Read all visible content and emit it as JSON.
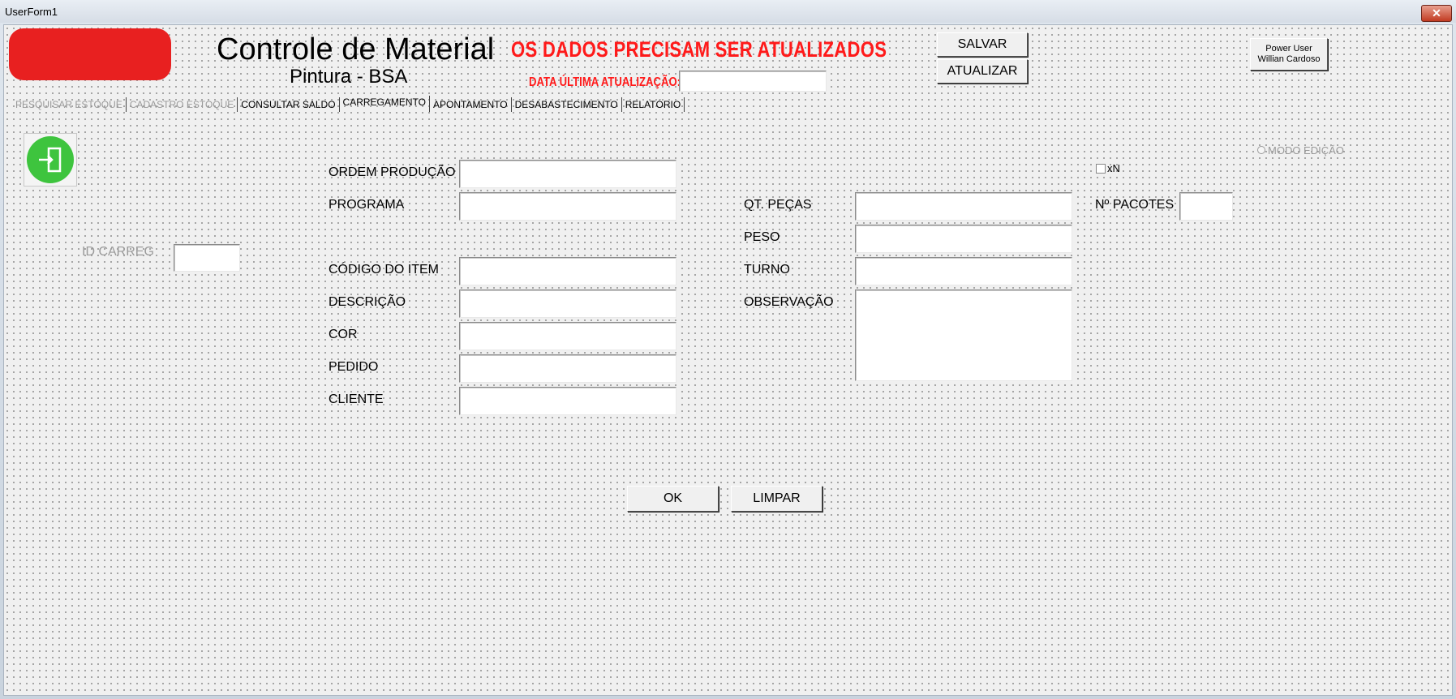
{
  "window": {
    "title": "UserForm1",
    "close_glyph": "✕"
  },
  "header": {
    "title": "Controle de Material",
    "subtitle": "Pintura - BSA",
    "warning": "OS DADOS PRECISAM SER ATUALIZADOS",
    "date_label": "DATA ÚLTIMA ATUALIZAÇÃO:",
    "date_value": "",
    "save_button": "SALVAR",
    "update_button": "ATUALIZAR",
    "user_button_line1": "Power User",
    "user_button_line2": "Willian Cardoso",
    "logo_color": "#e82020"
  },
  "tabs": [
    {
      "label": "PESQUISAR ESTOQUE",
      "state": "disabled"
    },
    {
      "label": "CADASTRO ESTOQUE",
      "state": "disabled"
    },
    {
      "label": "CONSULTAR SALDO",
      "state": "normal"
    },
    {
      "label": "CARREGAMENTO",
      "state": "active"
    },
    {
      "label": "APONTAMENTO",
      "state": "normal"
    },
    {
      "label": "DESABASTECIMENTO",
      "state": "normal"
    },
    {
      "label": "RELATÓRIO",
      "state": "normal"
    }
  ],
  "form": {
    "exit_icon": "exit-icon",
    "id_carreg_label": "ID CARREG",
    "ordem_producao_label": "ORDEM PRODUÇÃO",
    "programa_label": "PROGRAMA",
    "codigo_item_label": "CÓDIGO DO ITEM",
    "descricao_label": "DESCRIÇÃO",
    "cor_label": "COR",
    "pedido_label": "PEDIDO",
    "cliente_label": "CLIENTE",
    "qt_pecas_label": "QT. PEÇAS",
    "peso_label": "PESO",
    "turno_label": "TURNO",
    "observacao_label": "OBSERVAÇÃO",
    "pacotes_label": "Nº PACOTES",
    "xn_label": "xN",
    "modo_edicao_label": "MODO EDIÇÃO",
    "ok_button": "OK",
    "limpar_button": "LIMPAR",
    "exit_icon_color": "#3ec43e"
  }
}
